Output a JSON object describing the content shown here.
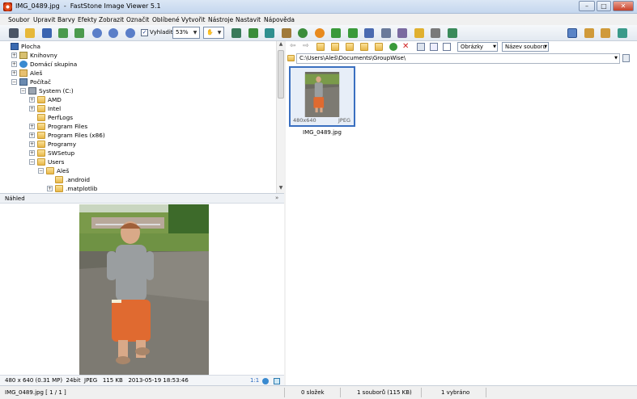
{
  "window": {
    "title": "IMG_0489.jpg  -  FastStone Image Viewer 5.1",
    "minimize": "–",
    "maximize": "□",
    "close": "✕"
  },
  "menu": [
    "Soubor",
    "Upravit",
    "Barvy",
    "Efekty",
    "Zobrazit",
    "Označit",
    "Oblíbené",
    "Vytvořit",
    "Nástroje",
    "Nastavit",
    "Nápověda"
  ],
  "toolbar": {
    "fit_label": "Vyhladit",
    "fit_checked": "✓",
    "zoom": "53%",
    "hand": "✋"
  },
  "tree": [
    {
      "label": "Plocha",
      "indent": 0,
      "exp": "",
      "icon": "desktop-icon"
    },
    {
      "label": "Knihovny",
      "indent": 1,
      "exp": "+",
      "icon": "libraries-icon"
    },
    {
      "label": "Domácí skupina",
      "indent": 1,
      "exp": "+",
      "icon": "homegroup-icon"
    },
    {
      "label": "Aleš",
      "indent": 1,
      "exp": "+",
      "icon": "user-folder-icon"
    },
    {
      "label": "Počítač",
      "indent": 1,
      "exp": "−",
      "icon": "computer-icon"
    },
    {
      "label": "System (C:)",
      "indent": 2,
      "exp": "−",
      "icon": "drive-icon"
    },
    {
      "label": "AMD",
      "indent": 3,
      "exp": "+",
      "icon": "folder-icon"
    },
    {
      "label": "Intel",
      "indent": 3,
      "exp": "+",
      "icon": "folder-icon"
    },
    {
      "label": "PerfLogs",
      "indent": 3,
      "exp": "",
      "icon": "folder-icon"
    },
    {
      "label": "Program Files",
      "indent": 3,
      "exp": "+",
      "icon": "folder-icon"
    },
    {
      "label": "Program Files (x86)",
      "indent": 3,
      "exp": "+",
      "icon": "folder-icon"
    },
    {
      "label": "Programy",
      "indent": 3,
      "exp": "+",
      "icon": "folder-icon"
    },
    {
      "label": "SWSetup",
      "indent": 3,
      "exp": "+",
      "icon": "folder-icon"
    },
    {
      "label": "Users",
      "indent": 3,
      "exp": "−",
      "icon": "folder-icon"
    },
    {
      "label": "Aleš",
      "indent": 4,
      "exp": "−",
      "icon": "folder-icon"
    },
    {
      "label": ".android",
      "indent": 5,
      "exp": "",
      "icon": "folder-icon"
    },
    {
      "label": ".matplotlib",
      "indent": 5,
      "exp": "+",
      "icon": "folder-icon"
    }
  ],
  "preview": {
    "title": "Náhled",
    "collapse": "»"
  },
  "image_info": "480 x 640 (0.31 MP)  24bit  JPEG   115 KB   2013-05-19 18:53:46",
  "info_icons": {
    "ratio": "1:1"
  },
  "right_toolbar": {
    "filter": "Obrázky",
    "sort": "Název souboru"
  },
  "path": "C:\\Users\\Aleš\\Documents\\GroupWise\\",
  "thumbnail": {
    "dims": "480x640",
    "format": "JPEG",
    "name": "IMG_0489.jpg"
  },
  "status": {
    "file": "IMG_0489.jpg [ 1 / 1 ]",
    "folders": "0 složek",
    "files": "1 souborů (115 KB)",
    "selected": "1 vybráno"
  },
  "colors": {
    "accent": "#3a6fc0",
    "title_bg": "#c5d7ee"
  }
}
